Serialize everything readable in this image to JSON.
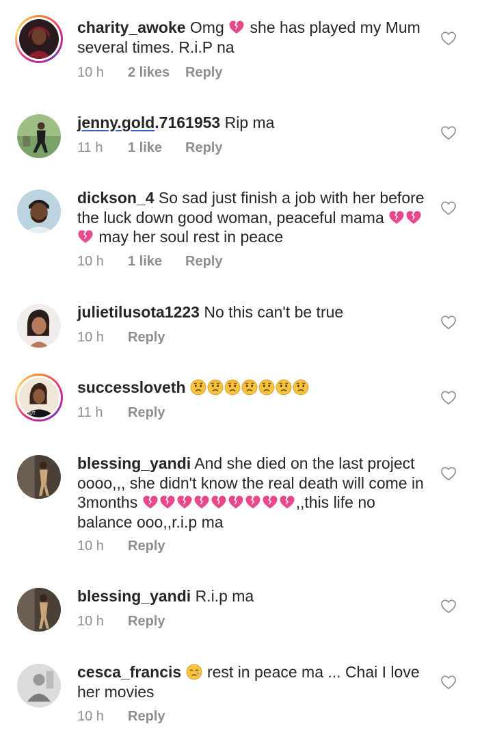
{
  "comments": [
    {
      "username": "charity_awoke",
      "text_before": "Omg",
      "text_after": "she has played my Mum several times. R.i.P na",
      "time": "10 h",
      "likes": "2 likes",
      "reply": "Reply"
    },
    {
      "username": "jenny.gold",
      "username_rest": ".7161953",
      "text": "Rip ma",
      "time": "11 h",
      "likes": "1 like",
      "reply": "Reply"
    },
    {
      "username": "dickson_4",
      "text_before": "So sad just finish a job with her before the luck down good woman, peaceful mama",
      "text_after": "may her soul rest in peace",
      "time": "10 h",
      "likes": "1 like",
      "reply": "Reply"
    },
    {
      "username": "julietilusota1223",
      "text": "No this can't be true",
      "time": "10 h",
      "reply": "Reply"
    },
    {
      "username": "successloveth",
      "time": "11 h",
      "reply": "Reply"
    },
    {
      "username": "blessing_yandi",
      "text_before": "And she died on the last project oooo,,, she didn't know the real death will come in 3months",
      "text_after": ",,this life no balance ooo,,r.i.p ma",
      "time": "10 h",
      "reply": "Reply"
    },
    {
      "username": "blessing_yandi",
      "text": "R.i.p ma",
      "time": "10 h",
      "reply": "Reply"
    },
    {
      "username": "cesca_francis",
      "text_after": "rest in peace ma ... Chai I love her movies",
      "time": "10 h",
      "reply": "Reply"
    }
  ],
  "icons": {
    "like": "heart-outline-icon",
    "broken_heart": "broken-heart-emoji",
    "worried_face": "worried-face-emoji",
    "crying_face": "crying-face-emoji"
  },
  "colors": {
    "text": "#262626",
    "meta": "#8e8e8e",
    "broken_heart": "#e8498a",
    "emoji_yellow": "#f7c23c"
  }
}
